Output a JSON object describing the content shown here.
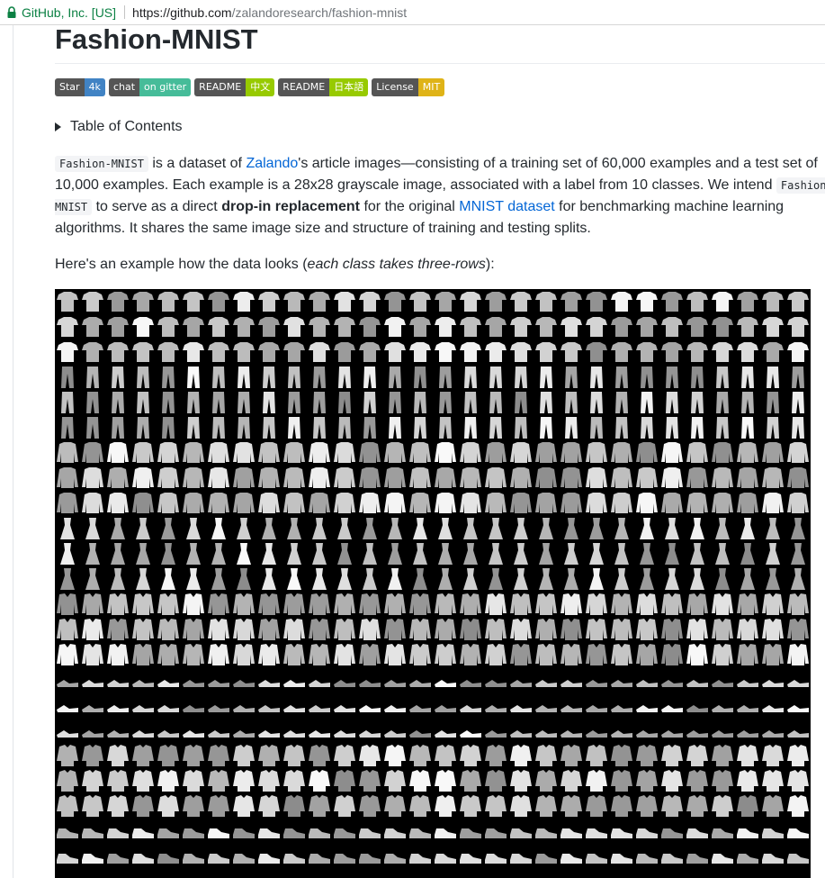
{
  "browser": {
    "site_identity": "GitHub, Inc. [US]",
    "url_host": "https://github.com",
    "url_path": "/zalandoresearch/fashion-mnist",
    "lock_icon": "lock-icon"
  },
  "readme": {
    "title": "Fashion-MNIST",
    "badges": [
      {
        "left": "Star",
        "right": "4k",
        "color": "#4183c4"
      },
      {
        "left": "chat",
        "right": "on gitter",
        "color": "#46bc99"
      },
      {
        "left": "README",
        "right": "中文",
        "color": "#97ca00"
      },
      {
        "left": "README",
        "right": "日本語",
        "color": "#97ca00"
      },
      {
        "left": "License",
        "right": "MIT",
        "color": "#dfb317"
      }
    ],
    "toc_label": "Table of Contents",
    "para": {
      "code1": "Fashion-MNIST",
      "t1": " is a dataset of ",
      "link_zalando": "Zalando",
      "t2": "'s article images—consisting of a training set of 60,000 examples and a test set of 10,000 examples. Each example is a 28x28 grayscale image, associated with a label from 10 classes. We intend ",
      "code2": "Fashion-MNIST",
      "t3": " to serve as a direct ",
      "bold": "drop-in replacement",
      "t4": " for the original ",
      "link_mnist": "MNIST dataset",
      "t5": " for benchmarking machine learning algorithms. It shares the same image size and structure of training and testing splits."
    },
    "example_prefix": "Here's an example how the data looks (",
    "example_em": "each class takes three-rows",
    "example_suffix": "):",
    "sample_grid": {
      "columns": 30,
      "classes": [
        "t-shirt",
        "trouser",
        "pullover",
        "dress",
        "coat",
        "sandal",
        "shirt",
        "sneaker"
      ],
      "rows_per_class": 3
    }
  }
}
